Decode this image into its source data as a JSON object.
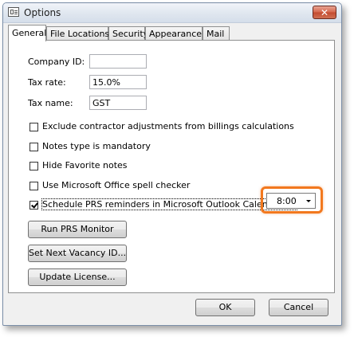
{
  "window": {
    "title": "Options"
  },
  "tabs": [
    {
      "label": "General"
    },
    {
      "label": "File Locations"
    },
    {
      "label": "Security"
    },
    {
      "label": "Appearance"
    },
    {
      "label": "Mail"
    }
  ],
  "general": {
    "company_id": {
      "label": "Company ID:",
      "value": ""
    },
    "tax_rate": {
      "label": "Tax rate:",
      "value": "15.0%"
    },
    "tax_name": {
      "label": "Tax name:",
      "value": "GST"
    },
    "checkboxes": [
      {
        "label": "Exclude  contractor adjustments from billings calculations",
        "checked": false
      },
      {
        "label": "Notes type is mandatory",
        "checked": false
      },
      {
        "label": "Hide Favorite notes",
        "checked": false
      },
      {
        "label": "Use Microsoft Office spell checker",
        "checked": false
      },
      {
        "label": "Schedule PRS reminders in Microsoft Outlook Calendar at:",
        "checked": true
      }
    ],
    "reminder_time": "8:00",
    "buttons": {
      "run_prs": "Run PRS Monitor",
      "set_vacancy": "Set Next Vacancy ID...",
      "update_license": "Update License..."
    }
  },
  "footer": {
    "ok": "OK",
    "cancel": "Cancel"
  },
  "colors": {
    "highlight": "#f2781e",
    "close_button": "#c34a2f"
  }
}
